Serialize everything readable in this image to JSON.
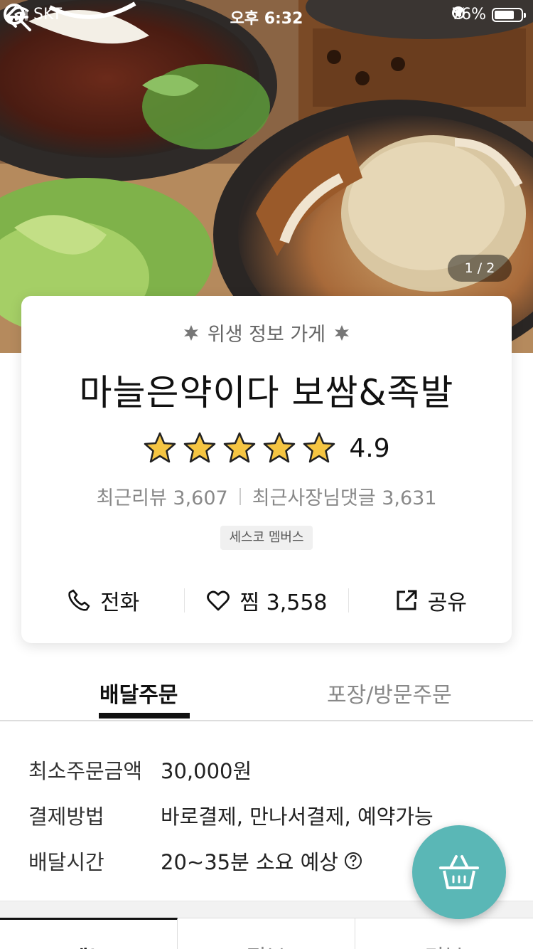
{
  "status_bar": {
    "carrier": "SKT",
    "time": "오후 6:32",
    "battery_percent": "76%",
    "battery_level": 0.76
  },
  "hero": {
    "page_counter": "1 / 2",
    "back_icon": "arrow-left-icon",
    "search_icon": "search-icon"
  },
  "store": {
    "hygiene_label": "위생 정보 가게",
    "name": "마늘은약이다 보쌈&족발",
    "rating": "4.9",
    "rating_value": 4.9,
    "star_count": 5,
    "star_color": "#f5c542",
    "recent_reviews": "최근리뷰 3,607",
    "owner_replies": "최근사장님댓글 3,631",
    "badge": "세스코 멤버스"
  },
  "actions": {
    "call_label": "전화",
    "like_label": "찜 3,558",
    "share_label": "공유"
  },
  "order_tabs": {
    "delivery": "배달주문",
    "pickup": "포장/방문주문"
  },
  "info": {
    "min_order_label": "최소주문금액",
    "min_order_value": "30,000원",
    "payment_label": "결제방법",
    "payment_value": "바로결제, 만나서결제, 예약가능",
    "delivery_time_label": "배달시간",
    "delivery_time_value": "20~35분 소요 예상"
  },
  "bottom_tabs": {
    "menu": "메뉴",
    "info": "정보",
    "review": "리뷰"
  },
  "colors": {
    "cart_fab": "#5ab7b6"
  }
}
